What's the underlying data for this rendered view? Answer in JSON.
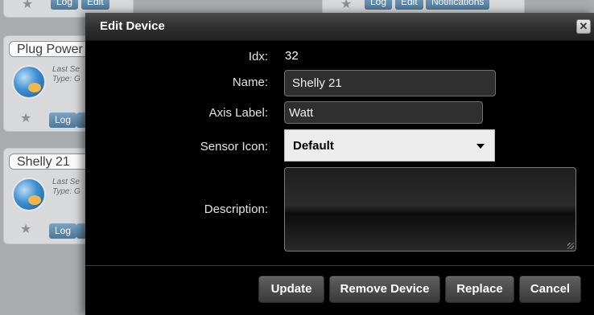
{
  "background": {
    "top_buttons": [
      "Log",
      "Edit",
      "Notifications"
    ],
    "tiles": [
      {
        "title": "Plug Power",
        "meta_line1": "Last Se",
        "meta_line2": "Type: G",
        "log": "Log"
      },
      {
        "title": "Shelly 21",
        "meta_line1": "Last Se",
        "meta_line2": "Type: G",
        "log": "Log"
      }
    ]
  },
  "dialog": {
    "title": "Edit Device",
    "close_icon": "✕",
    "fields": {
      "idx": {
        "label": "Idx:",
        "value": "32"
      },
      "name": {
        "label": "Name:",
        "value": "Shelly 21"
      },
      "axis_label": {
        "label": "Axis Label:",
        "value": "Watt"
      },
      "sensor_icon": {
        "label": "Sensor Icon:",
        "value": "Default"
      },
      "description": {
        "label": "Description:",
        "value": ""
      }
    },
    "buttons": {
      "update": "Update",
      "remove_device": "Remove Device",
      "replace": "Replace",
      "cancel": "Cancel"
    }
  },
  "colors": {
    "dialog_bg": "#000000",
    "header_bg": "#333333",
    "button_bg": "#4a4a4a",
    "tile_button": "#5a84a5"
  }
}
